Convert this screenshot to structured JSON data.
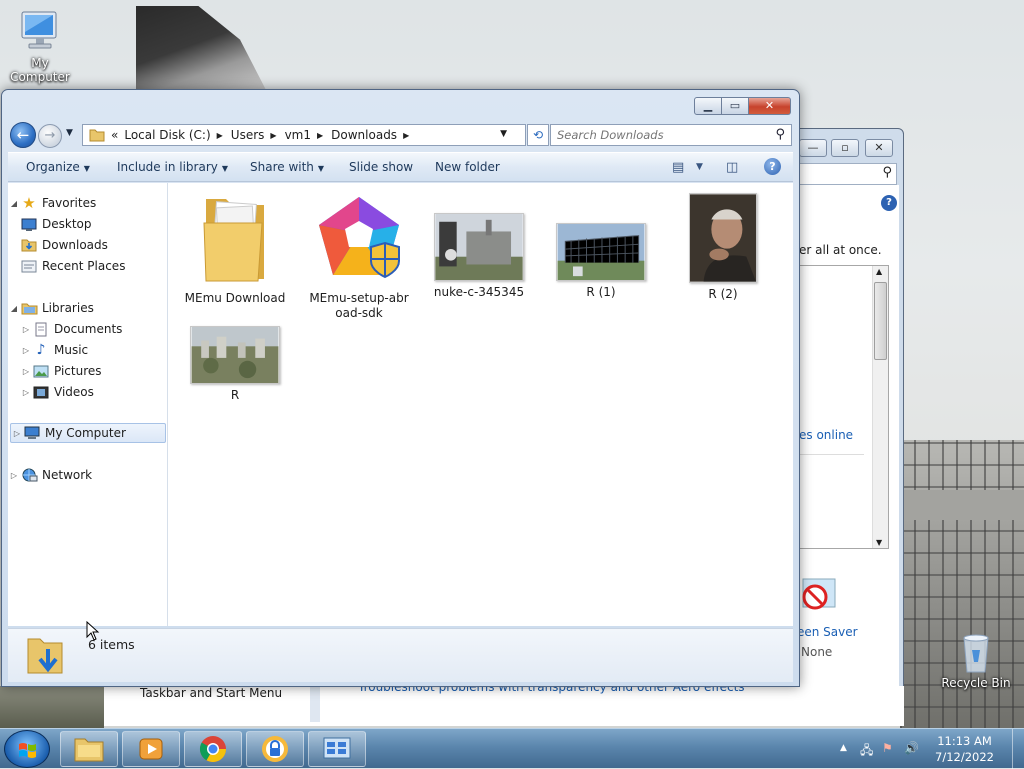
{
  "desktop": {
    "my_computer_label": "My Computer",
    "recycle_bin_label": "Recycle Bin"
  },
  "background_window": {
    "text_all_at_once": "er all at once.",
    "text_online": "es online",
    "screen_saver_label": "een Saver",
    "screen_saver_value": "None",
    "lower_left_text": "Taskbar and Start Menu",
    "lower_right_text": "Troubleshoot problems with transparency and other Aero effects"
  },
  "explorer": {
    "breadcrumb_prefix": "«",
    "breadcrumbs": [
      "Local Disk (C:)",
      "Users",
      "vm1",
      "Downloads"
    ],
    "search_placeholder": "Search Downloads",
    "toolbar": {
      "organize": "Organize",
      "include_in_library": "Include in library",
      "share_with": "Share with",
      "slide_show": "Slide show",
      "new_folder": "New folder"
    },
    "nav": {
      "favorites": "Favorites",
      "desktop": "Desktop",
      "downloads": "Downloads",
      "recent_places": "Recent Places",
      "libraries": "Libraries",
      "documents": "Documents",
      "music": "Music",
      "pictures": "Pictures",
      "videos": "Videos",
      "my_computer": "My Computer",
      "network": "Network"
    },
    "files": [
      {
        "name": "MEmu Download"
      },
      {
        "name": "MEmu-setup-abr oad-sdk"
      },
      {
        "name": "nuke-c-345345"
      },
      {
        "name": "R (1)"
      },
      {
        "name": "R (2)"
      },
      {
        "name": "R"
      }
    ],
    "status": "6 items"
  },
  "taskbar": {
    "time": "11:13 AM",
    "date": "7/12/2022"
  },
  "colors": {
    "accent": "#2d6fc4",
    "titlebar": "#cddcee",
    "close": "#c7432d",
    "taskbar": "#5b86ad"
  }
}
